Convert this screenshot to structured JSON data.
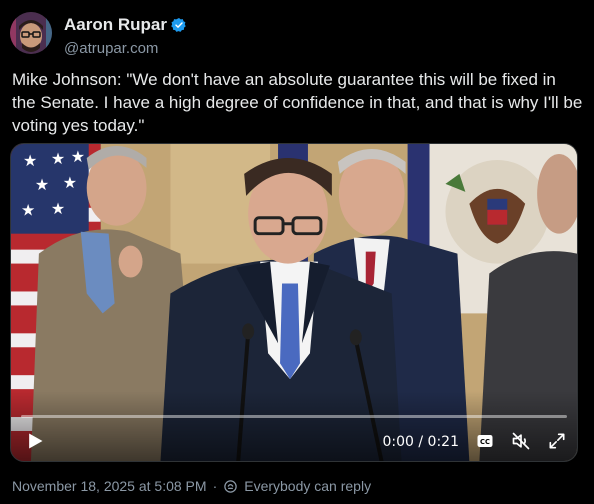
{
  "author": {
    "name": "Aaron Rupar",
    "handle": "@atrupar.com"
  },
  "post": {
    "text": "Mike Johnson: \"We don't have an absolute guarantee this will be fixed in the Senate. I have a high degree of confidence in that, and that is why I'll be voting yes today.\""
  },
  "video": {
    "time": "0:00 / 0:21",
    "progress_fraction": 0.0,
    "controls": {
      "play_icon": "play-icon",
      "captions_icon": "captions-icon",
      "mute_icon": "volume-muted-icon",
      "fullscreen_icon": "fullscreen-icon"
    }
  },
  "footer": {
    "timestamp": "November 18, 2025 at 5:08 PM",
    "reply_setting": "Everybody can reply"
  },
  "colors": {
    "background": "#000000",
    "text": "#e7e9ea",
    "muted": "#8b98a5",
    "accent": "#1d9bf0"
  }
}
